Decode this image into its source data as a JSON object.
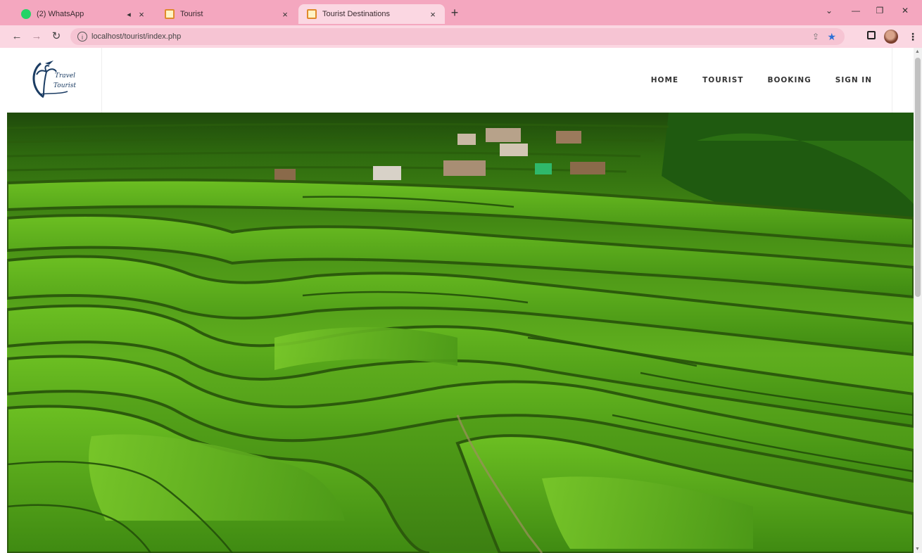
{
  "browser": {
    "tabs": [
      {
        "label": "(2) WhatsApp",
        "icon": "whatsapp-icon",
        "active": false
      },
      {
        "label": "Tourist",
        "icon": "page-icon",
        "active": false
      },
      {
        "label": "Tourist Destinations",
        "icon": "page-icon",
        "active": true
      }
    ],
    "new_tab": "+",
    "url": "localhost/tourist/index.php",
    "colors": {
      "tabstrip": "#f4a7bf",
      "toolbar": "#fbd7e2",
      "bookmark_star": "#2b6fd6"
    }
  },
  "site": {
    "logo_text_line1": "Travel",
    "logo_text_line2": "Tourist",
    "nav": [
      {
        "label": "HOME"
      },
      {
        "label": "TOURIST"
      },
      {
        "label": "BOOKING"
      },
      {
        "label": "SIGN IN"
      }
    ],
    "hero_image": "rice-terraces-with-village"
  }
}
